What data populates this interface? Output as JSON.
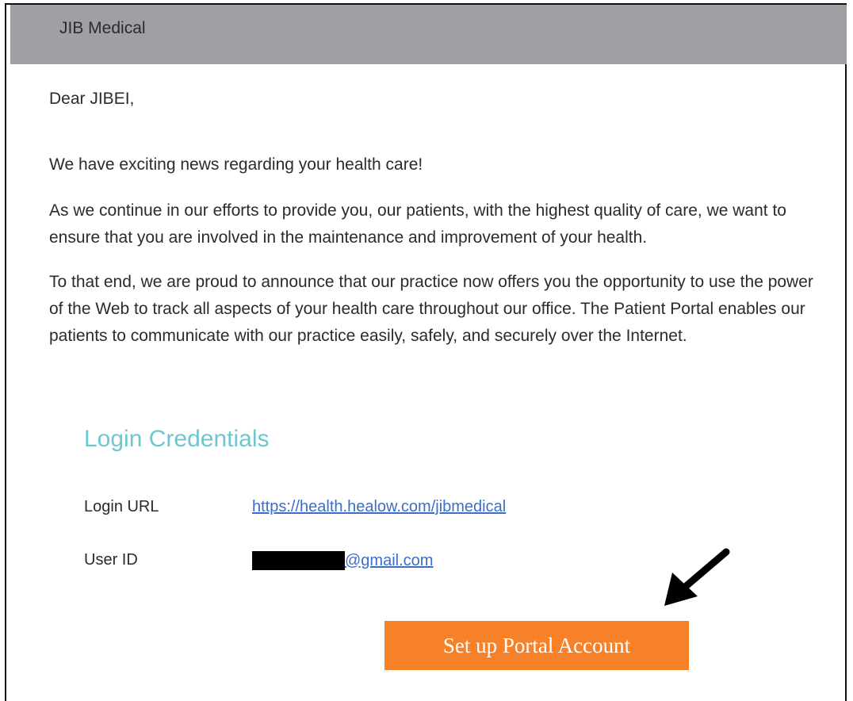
{
  "header": {
    "title": "JIB Medical"
  },
  "email": {
    "greeting": "Dear JIBEI,",
    "news_line": "We have exciting news regarding your health care!",
    "paragraph_1": "As we continue in our efforts to provide you, our patients, with the highest quality of care, we want to ensure that you are involved in the maintenance and improvement of your health.",
    "paragraph_2": "To that end, we are proud to announce that our practice now offers you the opportunity to use the power of the Web to track all aspects of your health care throughout our office. The Patient Portal enables our patients to communicate with our practice easily, safely, and securely over the Internet."
  },
  "credentials": {
    "heading": "Login Credentials",
    "login_url_label": "Login URL",
    "login_url_value": "https://health.healow.com/jibmedical",
    "user_id_label": "User ID",
    "user_id_domain": "@gmail.com"
  },
  "cta": {
    "label": "Set up Portal Account"
  },
  "icons": {
    "annotation": "arrow-pointing-down-left-icon"
  },
  "colors": {
    "header_bg": "#9fa0a3",
    "heading_teal": "#6ec6cf",
    "link_blue": "#3b6fc7",
    "cta_orange": "#f78129"
  }
}
